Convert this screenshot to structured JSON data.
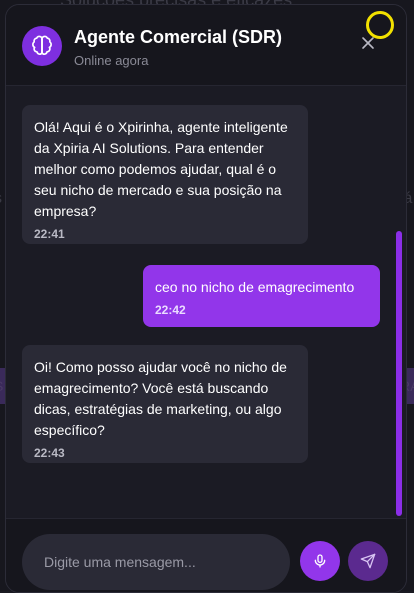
{
  "background": {
    "top_text": "Soluções precisas e eficazes",
    "left_fragment_1": "s",
    "right_fragment_1": "iá",
    "left_fragment_2": "S",
    "right_fragment_2": "RA"
  },
  "header": {
    "title": "Agente Comercial (SDR)",
    "status": "Online agora",
    "avatar_icon": "brain-icon",
    "close_icon": "close-icon"
  },
  "messages": [
    {
      "sender": "bot",
      "text": "Olá! Aqui é o Xpirinha, agente inteligente da Xpiria AI Solutions. Para entender melhor como podemos ajudar, qual é o seu nicho de mercado e sua posição na empresa?",
      "time": "22:41"
    },
    {
      "sender": "user",
      "text": "ceo no nicho de emagrecimento",
      "time": "22:42"
    },
    {
      "sender": "bot",
      "text": "Oi! Como posso ajudar você no nicho de emagrecimento? Você está buscando dicas, estratégias de marketing, ou algo específico?",
      "time": "22:43"
    }
  ],
  "composer": {
    "placeholder": "Digite uma mensagem...",
    "value": "",
    "mic_icon": "microphone-icon",
    "send_icon": "send-icon"
  },
  "colors": {
    "accent": "#9236ea",
    "accent_muted": "#5b2a8f",
    "bot_bubble": "#2a2a36",
    "highlight": "#f2e100"
  }
}
